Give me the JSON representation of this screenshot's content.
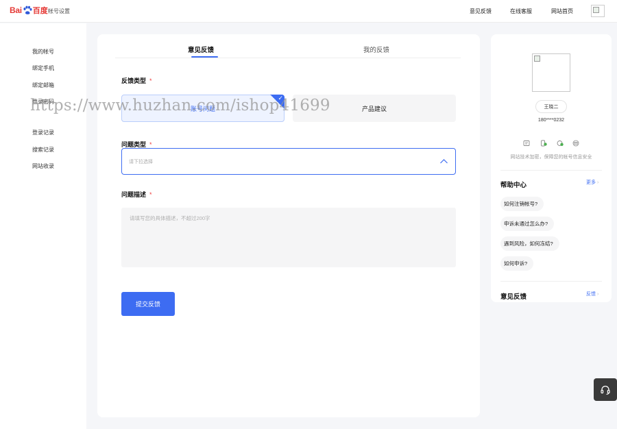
{
  "header": {
    "logo_bai": "Bai",
    "logo_cn": "百度",
    "site_title": "帐号设置",
    "nav": [
      "意见反馈",
      "在线客服",
      "网站首页"
    ]
  },
  "sidebar": {
    "items": [
      "我的帐号",
      "绑定手机",
      "绑定邮箱",
      "登录密码",
      "登录记录",
      "搜索记录",
      "网站收录"
    ]
  },
  "tabs": {
    "active": "意见反馈",
    "inactive": "我的反馈"
  },
  "form": {
    "type_label": "反馈类型",
    "required_mark": "*",
    "type_options": {
      "selected": "账号问题",
      "other": "产品建议"
    },
    "check_mark": "✓",
    "issue_label": "问题类型",
    "issue_placeholder": "请下拉选择",
    "desc_label": "问题描述",
    "desc_placeholder": "请填写您的具体描述，不超过200字",
    "submit_label": "提交反馈"
  },
  "profile": {
    "name": "王晓二",
    "phone": "180****0232",
    "security_text": "网站技术加密，保障您的帐号信息安全"
  },
  "help": {
    "title": "帮助中心",
    "more": "更多",
    "arrow": "›",
    "faqs": [
      "如何注销帐号?",
      "申诉未通过怎么办?",
      "遇到风险，如何冻结?",
      "如何申诉?"
    ]
  },
  "feedback": {
    "title": "意见反馈",
    "link": "反馈"
  },
  "watermark": "https://www.huzhan.com/ishop41699",
  "colors": {
    "accent": "#3d6cf2",
    "required": "#ee3b3b",
    "page_bg": "#f5f6f9"
  }
}
